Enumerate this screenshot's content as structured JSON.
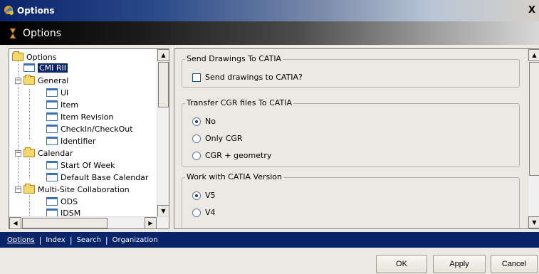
{
  "window": {
    "title": "Options",
    "close_label": "X"
  },
  "banner": {
    "title": "Options"
  },
  "tree": {
    "items": [
      {
        "label": "Options",
        "level": 0,
        "type": "folder"
      },
      {
        "label": "CMI RII",
        "level": 1,
        "type": "page",
        "selected": true
      },
      {
        "label": "General",
        "level": 1,
        "type": "folder"
      },
      {
        "label": "UI",
        "level": 2,
        "type": "page"
      },
      {
        "label": "Item",
        "level": 2,
        "type": "page"
      },
      {
        "label": "Item Revision",
        "level": 2,
        "type": "page"
      },
      {
        "label": "CheckIn/CheckOut",
        "level": 2,
        "type": "page"
      },
      {
        "label": "Identifier",
        "level": 2,
        "type": "page"
      },
      {
        "label": "Calendar",
        "level": 1,
        "type": "folder"
      },
      {
        "label": "Start Of Week",
        "level": 2,
        "type": "page"
      },
      {
        "label": "Default Base Calendar",
        "level": 2,
        "type": "page"
      },
      {
        "label": "Multi-Site Collaboration",
        "level": 1,
        "type": "folder"
      },
      {
        "label": "ODS",
        "level": 2,
        "type": "page"
      },
      {
        "label": "IDSM",
        "level": 2,
        "type": "page"
      }
    ]
  },
  "settings": {
    "send_drawings": {
      "title": "Send Drawings To CATIA",
      "checkbox_label": "Send drawings to CATIA?",
      "checked": false
    },
    "transfer_cgr": {
      "title": "Transfer CGR files To CATIA",
      "options": [
        "No",
        "Only CGR",
        "CGR + geometry"
      ],
      "selected": "No"
    },
    "catia_version": {
      "title": "Work with CATIA Version",
      "options": [
        "V5",
        "V4"
      ],
      "selected": "V5"
    }
  },
  "nav": {
    "links": [
      "Options",
      "Index",
      "Search",
      "Organization"
    ],
    "active": "Options"
  },
  "footer": {
    "ok_label": "OK",
    "apply_label": "Apply",
    "cancel_label": "Cancel"
  },
  "colors": {
    "selection": "#0a246a",
    "navbar": "#0a246a",
    "dialog_bg": "#ece9e2"
  }
}
